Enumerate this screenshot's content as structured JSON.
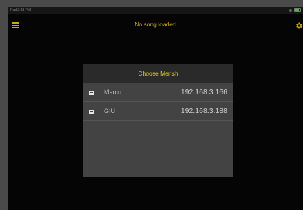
{
  "statusbar": {
    "carrier": "iPad  2:38 PM"
  },
  "topbar": {
    "title": "No song loaded",
    "menu_icon": "hamburger-menu-icon",
    "settings_icon": "gear-icon"
  },
  "dialog": {
    "title": "Choose Merish",
    "items": [
      {
        "name": "Marco",
        "ip": "192.168.3.166",
        "icon": "device-icon"
      },
      {
        "name": "GIU",
        "ip": "192.168.3.188",
        "icon": "device-icon"
      }
    ]
  },
  "colors": {
    "accent": "#c9a51a",
    "dialog_title": "#e8d020",
    "background": "#050505",
    "dialog_bg": "#434343",
    "battery": "#3dc43d"
  }
}
